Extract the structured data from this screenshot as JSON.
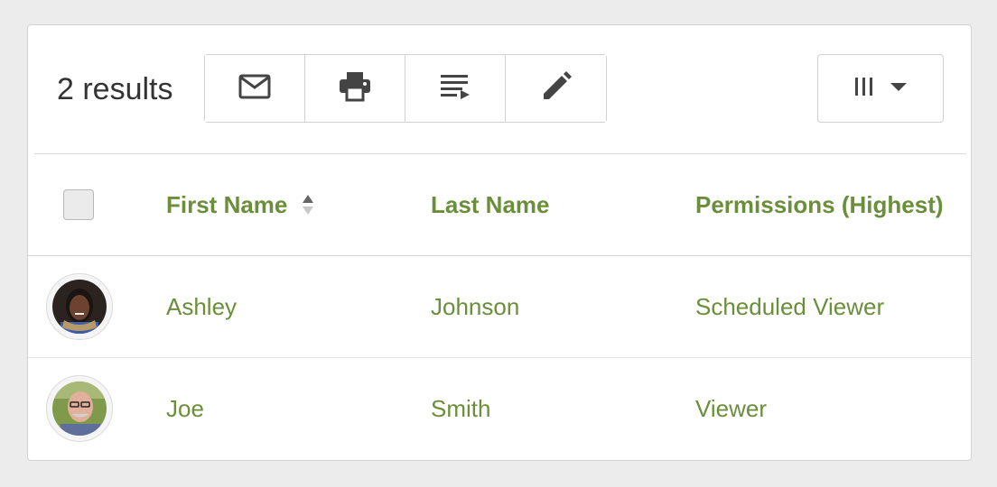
{
  "toolbar": {
    "results_label": "2 results",
    "buttons": [
      {
        "icon": "mail-icon"
      },
      {
        "icon": "print-icon"
      },
      {
        "icon": "playlist-icon"
      },
      {
        "icon": "pencil-icon"
      }
    ],
    "columns_button_icon": "columns-icon",
    "columns_caret_icon": "caret-down-icon"
  },
  "table": {
    "headers": {
      "first_name": "First Name",
      "last_name": "Last Name",
      "permissions": "Permissions (Highest)"
    },
    "sort_icon": "sort-icon",
    "rows": [
      {
        "first_name": "Ashley",
        "last_name": "Johnson",
        "permissions": "Scheduled Viewer"
      },
      {
        "first_name": "Joe",
        "last_name": "Smith",
        "permissions": "Viewer"
      }
    ]
  },
  "colors": {
    "accent": "#6b8e3a",
    "text": "#333333",
    "border": "#d0d0d0",
    "background": "#ececec"
  }
}
